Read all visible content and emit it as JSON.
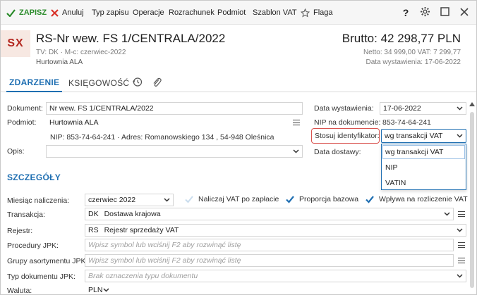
{
  "toolbar": {
    "save": "ZAPISZ",
    "cancel": "Anuluj",
    "doc_type": "Typ zapisu",
    "operations": "Operacje",
    "settlement": "Rozrachunek",
    "entity": "Podmiot",
    "vat_template": "Szablon VAT",
    "flag": "Flaga",
    "help": "?"
  },
  "header": {
    "badge": "SX",
    "title": "RS-Nr wew. FS 1/CENTRALA/2022",
    "meta": "TV: DK  ·  M-c: czerwiec-2022",
    "contractor": "Hurtownia ALA",
    "brutto": "Brutto: 42 298,77 PLN",
    "netto": "Netto: 34 999,00 VAT: 7 299,77",
    "issue_date": "Data wystawienia: 17-06-2022"
  },
  "tabs": [
    "ZDARZENIE",
    "KSIĘGOWOŚĆ"
  ],
  "form": {
    "document_label": "Dokument:",
    "document_value": "Nr wew. FS 1/CENTRALA/2022",
    "entity_label": "Podmiot:",
    "entity_value": "Hurtownia ALA",
    "entity_details": "NIP:  853-74-64-241  ·  Adres:  Romanowskiego 134 , 54-948 Oleśnica",
    "desc_label": "Opis:",
    "desc_value": "",
    "issue_date_label": "Data wystawienia:",
    "issue_date_value": "17-06-2022",
    "nip_label": "NIP na dokumencie:",
    "nip_value": "853-74-64-241",
    "identifier_label": "Stosuj identyfikator:",
    "identifier_value": "wg transakcji VAT",
    "delivery_label": "Data dostawy:",
    "identifier_options": [
      "wg transakcji VAT",
      "NIP",
      "VATIN"
    ]
  },
  "details": {
    "title": "SZCZEGÓŁY",
    "month_label": "Miesiąc naliczenia:",
    "month_value": "czerwiec 2022",
    "vat_on_payment": "Naliczaj VAT po zapłacie",
    "vat_on_payment_checked": false,
    "proportion": "Proporcja bazowa",
    "proportion_checked": true,
    "vat_settlement": "Wpływa na rozliczenie VAT",
    "vat_settlement_checked": true,
    "transaction_label": "Transakcja:",
    "transaction_code": "DK",
    "transaction_value": "Dostawa krajowa",
    "register_label": "Rejestr:",
    "register_code": "RS",
    "register_value": "Rejestr sprzedaży VAT",
    "jpk_proc_label": "Procedury JPK:",
    "jpk_proc_placeholder": "Wpisz symbol lub wciśnij F2 aby rozwinąć listę",
    "jpk_groups_label": "Grupy asortymentu JPK:",
    "jpk_groups_placeholder": "Wpisz symbol lub wciśnij F2 aby rozwinąć listę",
    "jpk_doc_label": "Typ dokumentu JPK:",
    "jpk_doc_placeholder": "Brak oznaczenia typu dokumentu",
    "currency_label": "Waluta:",
    "currency_value": "PLN"
  },
  "colors": {
    "accent": "#1f6fb2",
    "save_green": "#2a8b2a",
    "cancel_red": "#d9342b",
    "badge_bg": "#f7e8e2",
    "badge_fg": "#b3261e",
    "highlight": "#d9534f"
  }
}
